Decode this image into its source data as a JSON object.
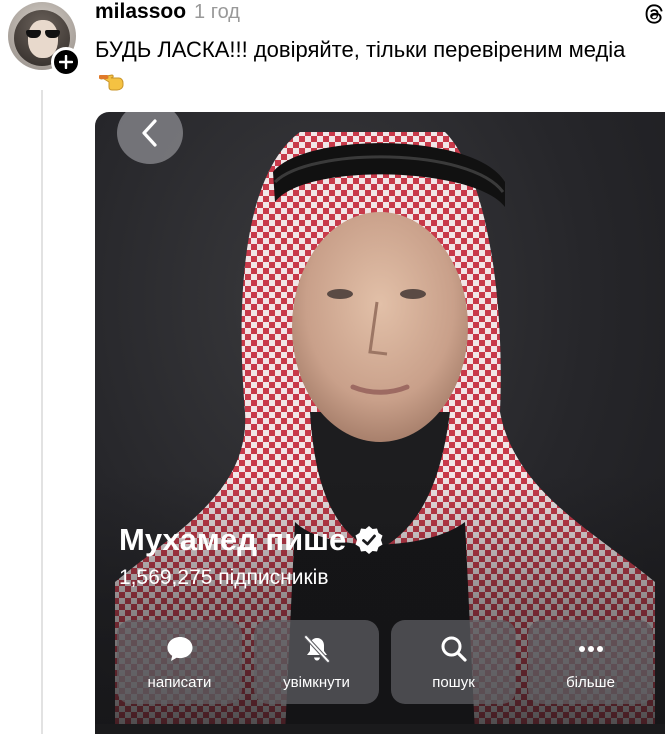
{
  "post": {
    "username": "milassoo",
    "time": "1 год",
    "text": "БУДЬ ЛАСКА!!! довіряйте, тільки перевіреним медіа",
    "emoji_icon": "pointing-hand-icon"
  },
  "media": {
    "profile_name": "Мухамед пише",
    "followers": "1,569,275 підписників",
    "actions": [
      {
        "label": "написати",
        "icon": "message-bubble-icon"
      },
      {
        "label": "увімкнути",
        "icon": "bell-off-icon"
      },
      {
        "label": "пошук",
        "icon": "search-icon"
      },
      {
        "label": "більше",
        "icon": "more-icon"
      }
    ]
  },
  "colors": {
    "accent": "#000000",
    "muted": "#999999",
    "keffiyeh": "#c83a4a"
  }
}
